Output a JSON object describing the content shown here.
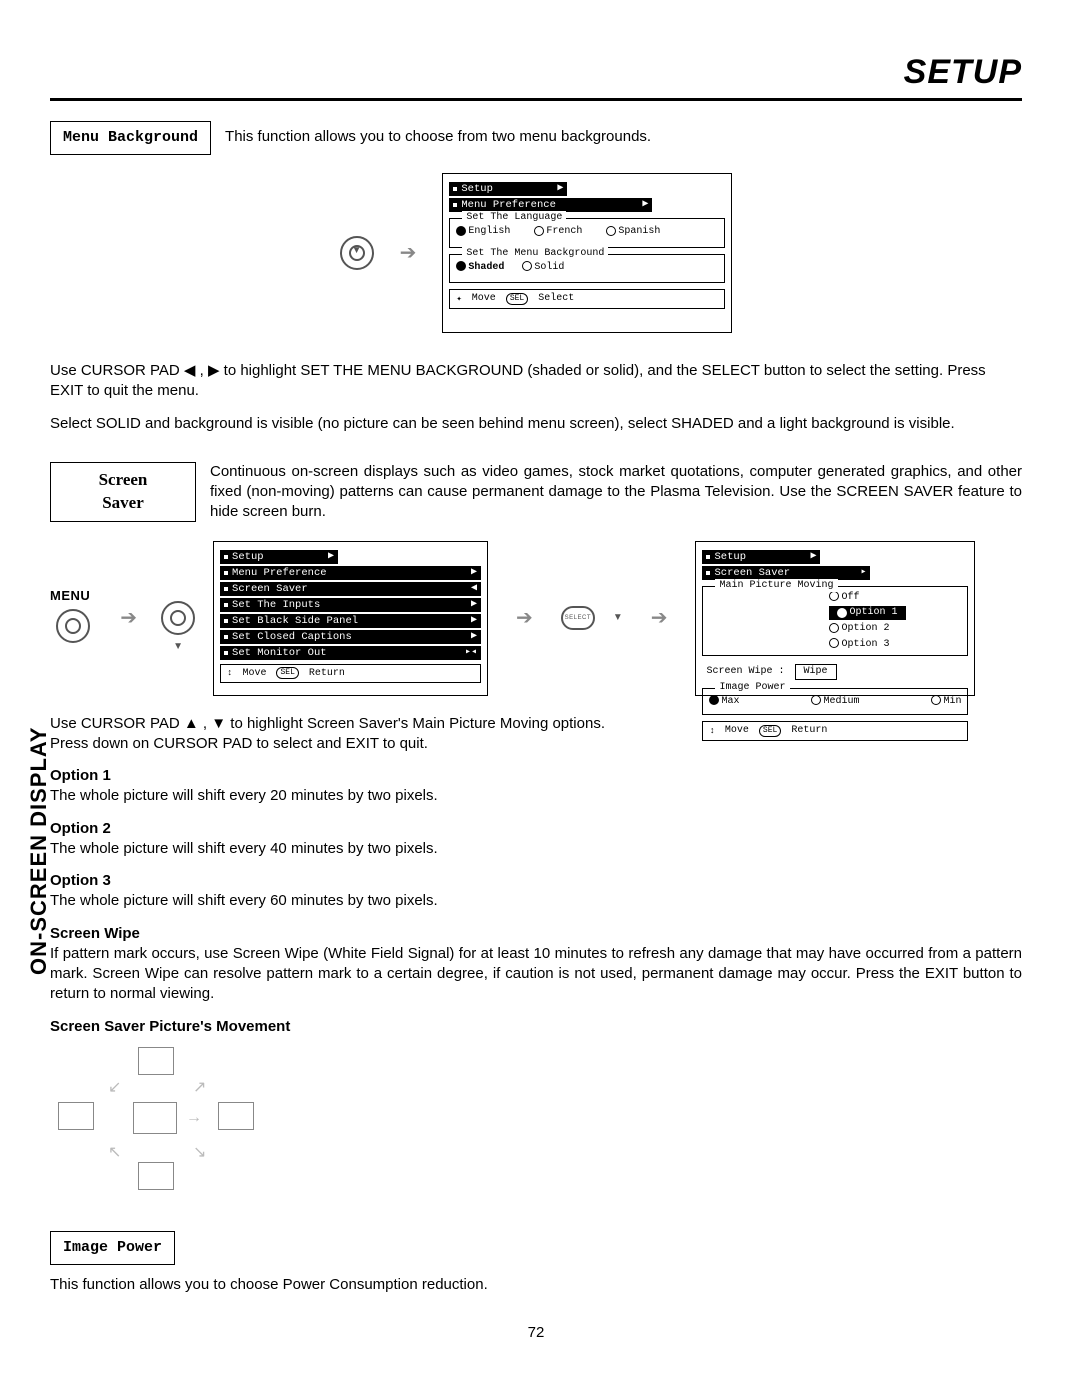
{
  "header": {
    "title": "SETUP"
  },
  "sidebar": {
    "label": "ON-SCREEN DISPLAY"
  },
  "menu_bg": {
    "box_label": "Menu Background",
    "intro": "This function allows you to choose from two menu backgrounds.",
    "osd": {
      "tab1": "Setup",
      "tab2": "Menu Preference",
      "group1_title": "Set The Language",
      "lang_english": "English",
      "lang_french": "French",
      "lang_spanish": "Spanish",
      "group2_title": "Set The Menu Background",
      "bg_shaded": "Shaded",
      "bg_solid": "Solid",
      "footer_move": "Move",
      "footer_sel_pill": "SEL",
      "footer_select": "Select"
    },
    "para1": "Use CURSOR PAD ◀ , ▶ to highlight SET THE MENU BACKGROUND (shaded or solid), and the SELECT button to select the setting. Press EXIT to quit the menu.",
    "para2": "Select SOLID and background is visible (no picture can be seen behind menu screen), select SHADED and a light background is visible."
  },
  "screen_saver": {
    "box_line1": "Screen",
    "box_line2": "Saver",
    "intro": "Continuous on-screen displays such as video games, stock market quotations, computer generated graphics, and other fixed (non-moving) patterns can cause permanent damage to the Plasma Television.  Use the SCREEN SAVER feature to hide screen burn.",
    "menu_label": "MENU",
    "osd_menu": {
      "tab1": "Setup",
      "items": [
        "Menu Preference",
        "Screen Saver",
        "Set The Inputs",
        "Set Black Side Panel",
        "Set Closed Captions",
        "Set Monitor Out"
      ],
      "footer_move": "Move",
      "footer_sel_pill": "SEL",
      "footer_return": "Return"
    },
    "osd_saver": {
      "tab1": "Setup",
      "tab2": "Screen Saver",
      "group_title": "Main Picture Moving",
      "opt_off": "Off",
      "opt1": "Option 1",
      "opt2": "Option 2",
      "opt3": "Option 3",
      "wipe_label": "Screen Wipe :",
      "wipe_value": "Wipe",
      "image_power_title": "Image Power",
      "ip_max": "Max",
      "ip_medium": "Medium",
      "ip_min": "Min",
      "footer_move": "Move",
      "footer_sel_pill": "SEL",
      "footer_return": "Return"
    },
    "instr1": "Use CURSOR PAD ▲ , ▼ to highlight Screen Saver's Main Picture Moving options.",
    "instr2": "Press down on CURSOR PAD to select and EXIT to quit.",
    "opt1_h": "Option 1",
    "opt1_t": "The whole picture will shift every 20 minutes by two pixels.",
    "opt2_h": "Option 2",
    "opt2_t": "The whole picture will shift every 40 minutes by two pixels.",
    "opt3_h": "Option 3",
    "opt3_t": "The whole picture will shift every 60 minutes by two pixels.",
    "wipe_h": "Screen Wipe",
    "wipe_t": "If pattern mark occurs, use Screen Wipe (White Field Signal) for at least 10 minutes to refresh any damage that may have occurred from a pattern mark.  Screen Wipe can resolve pattern mark to a certain degree, if caution is not used, permanent damage may occur.  Press the EXIT button to return to normal viewing.",
    "movement_h": "Screen Saver Picture's Movement",
    "image_power_box": "Image Power",
    "image_power_t": "This function allows you to choose Power Consumption reduction."
  },
  "page_number": "72"
}
